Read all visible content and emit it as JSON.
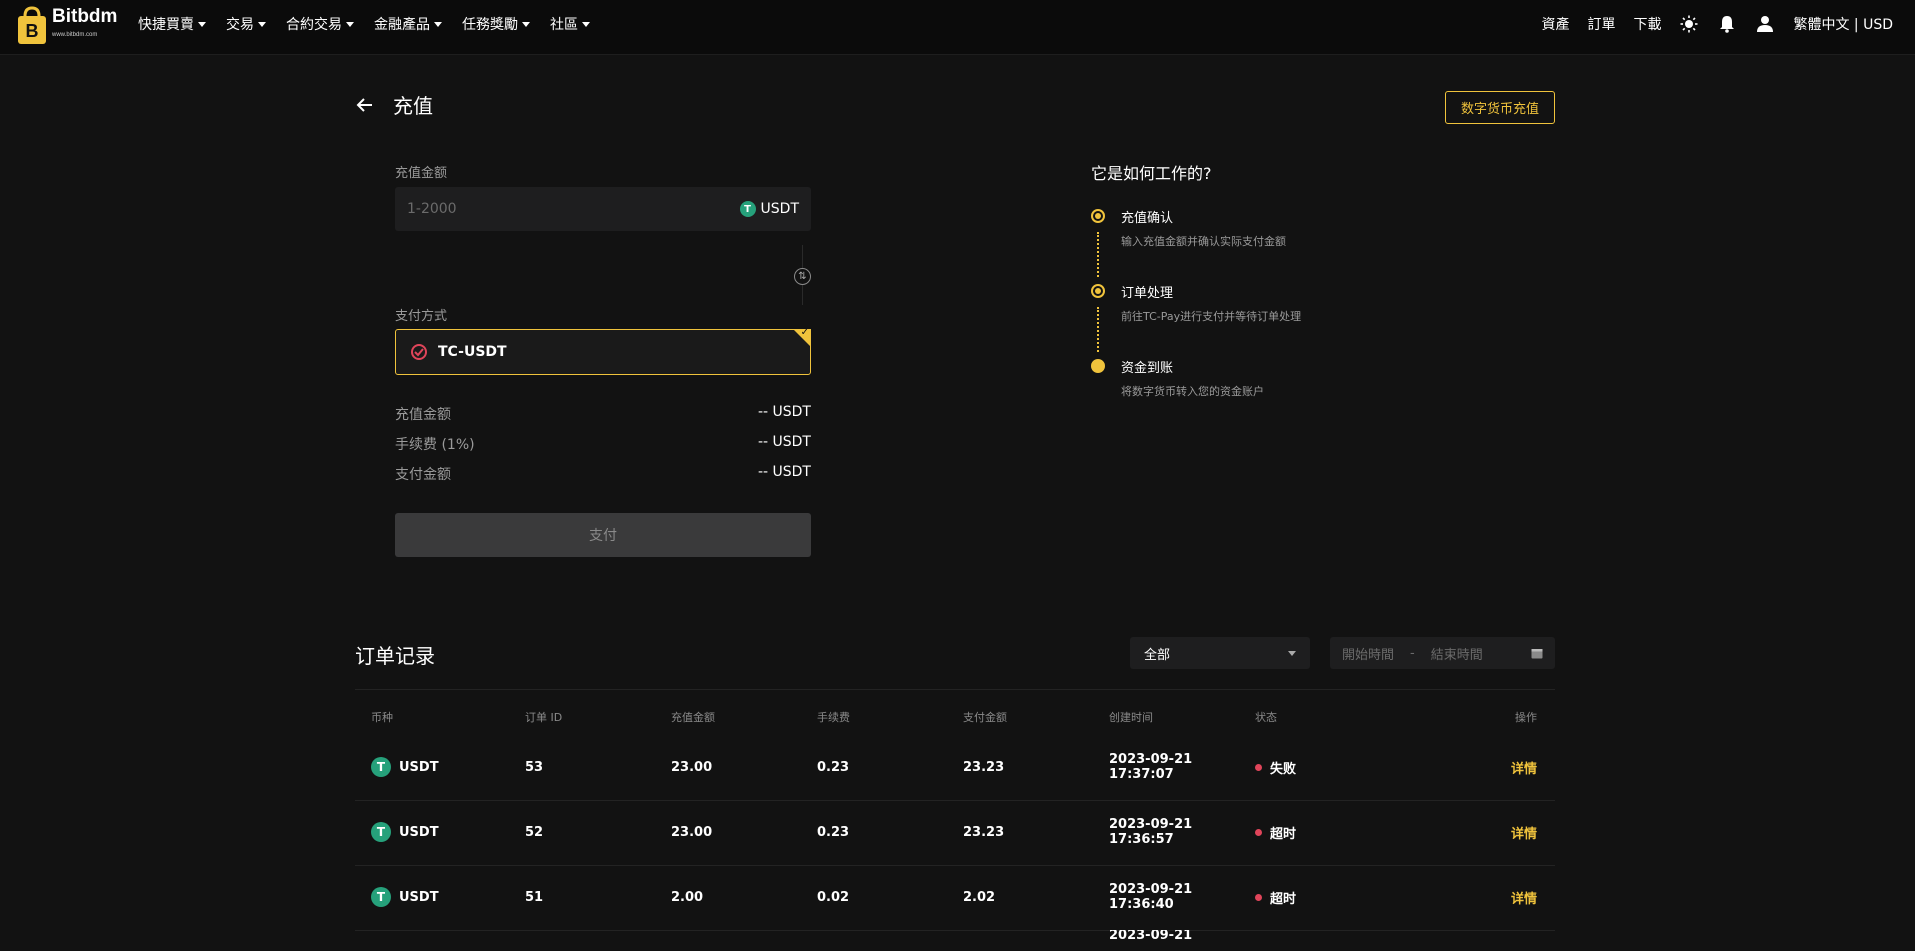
{
  "brand": {
    "name": "Bitbdm",
    "sub": "www.bitbdm.com"
  },
  "nav": {
    "items": [
      {
        "label": "快捷買賣"
      },
      {
        "label": "交易"
      },
      {
        "label": "合約交易"
      },
      {
        "label": "金融產品"
      },
      {
        "label": "任務獎勵"
      },
      {
        "label": "社區"
      }
    ],
    "right": {
      "assets": "資產",
      "orders": "訂單",
      "download": "下載",
      "locale": "繁體中文 | USD"
    }
  },
  "page": {
    "title": "充值",
    "crypto_button": "数字货币充值"
  },
  "form": {
    "amount_label": "充值金额",
    "amount_placeholder": "1-2000",
    "currency": "USDT",
    "method_label": "支付方式",
    "method": "TC-USDT",
    "summary": [
      {
        "key": "充值金额",
        "value": "-- USDT"
      },
      {
        "key": "手续费 (1%)",
        "value": "-- USDT"
      },
      {
        "key": "支付金额",
        "value": "-- USDT"
      }
    ],
    "pay_button": "支付"
  },
  "how": {
    "title": "它是如何工作的?",
    "steps": [
      {
        "title": "充值确认",
        "desc": "输入充值金额并确认实际支付金额"
      },
      {
        "title": "订单处理",
        "desc": "前往TC-Pay进行支付并等待订单处理"
      },
      {
        "title": "资金到账",
        "desc": "将数字货币转入您的资金账户"
      }
    ]
  },
  "records": {
    "title": "订单记录",
    "filter": "全部",
    "start_placeholder": "開始時間",
    "sep": "-",
    "end_placeholder": "結束時間",
    "headers": {
      "coin": "币种",
      "id": "订单 ID",
      "amount": "充值金额",
      "fee": "手续费",
      "paid": "支付金额",
      "created": "创建时间",
      "status": "状态",
      "action": "操作"
    },
    "rows": [
      {
        "coin": "USDT",
        "id": "53",
        "amount": "23.00",
        "fee": "0.23",
        "paid": "23.23",
        "date": "2023-09-21",
        "time": "17:37:07",
        "status": "失败",
        "action": "详情"
      },
      {
        "coin": "USDT",
        "id": "52",
        "amount": "23.00",
        "fee": "0.23",
        "paid": "23.23",
        "date": "2023-09-21",
        "time": "17:36:57",
        "status": "超时",
        "action": "详情"
      },
      {
        "coin": "USDT",
        "id": "51",
        "amount": "2.00",
        "fee": "0.02",
        "paid": "2.02",
        "date": "2023-09-21",
        "time": "17:36:40",
        "status": "超时",
        "action": "详情"
      },
      {
        "coin": "",
        "id": "",
        "amount": "",
        "fee": "",
        "paid": "",
        "date": "2023-09-21",
        "time": "",
        "status": "",
        "action": ""
      }
    ]
  },
  "colors": {
    "accent": "#f0c33c",
    "status_error": "#e0455a",
    "tether": "#26a17b",
    "background": "#121212"
  }
}
